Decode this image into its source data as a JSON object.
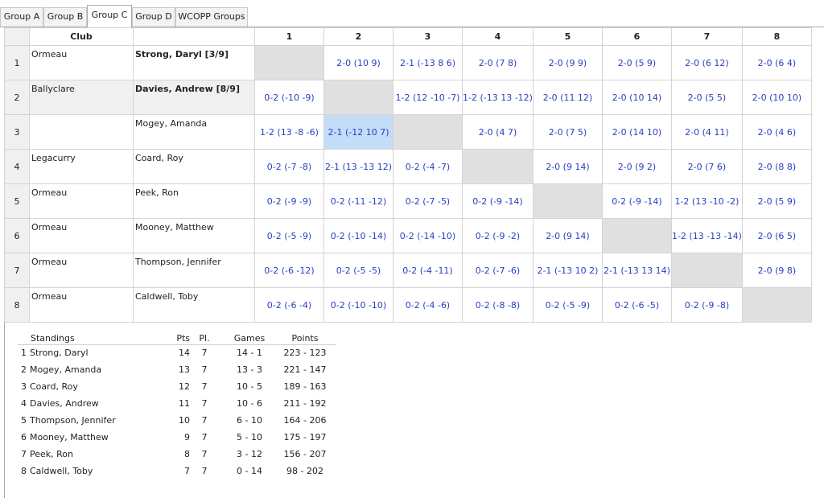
{
  "tabs": [
    {
      "label": "Group A",
      "active": false
    },
    {
      "label": "Group B",
      "active": false
    },
    {
      "label": "Group C",
      "active": true
    },
    {
      "label": "Group D",
      "active": false
    },
    {
      "label": "WCOPP Groups",
      "active": false
    }
  ],
  "grid": {
    "club_header": "Club",
    "columns": [
      "1",
      "2",
      "3",
      "4",
      "5",
      "6",
      "7",
      "8"
    ],
    "rows": [
      {
        "num": "1",
        "club": "Ormeau",
        "player": "Strong, Daryl [3/9]",
        "bold": true,
        "scores": [
          "",
          "2-0 (10 9)",
          "2-1 (-13 8 6)",
          "2-0 (7 8)",
          "2-0 (9 9)",
          "2-0 (5 9)",
          "2-0 (6 12)",
          "2-0 (6 4)"
        ]
      },
      {
        "num": "2",
        "club": "Ballyclare",
        "player": "Davies, Andrew [8/9]",
        "bold": true,
        "scores": [
          "0-2 (-10 -9)",
          "",
          "1-2 (12 -10 -7)",
          "1-2 (-13 13 -12)",
          "2-0 (11 12)",
          "2-0 (10 14)",
          "2-0 (5 5)",
          "2-0 (10 10)"
        ]
      },
      {
        "num": "3",
        "club": "",
        "player": "Mogey, Amanda",
        "bold": false,
        "scores": [
          "1-2 (13 -8 -6)",
          "2-1 (-12 10 7)",
          "",
          "2-0 (4 7)",
          "2-0 (7 5)",
          "2-0 (14 10)",
          "2-0 (4 11)",
          "2-0 (4 6)"
        ]
      },
      {
        "num": "4",
        "club": "Legacurry",
        "player": "Coard, Roy",
        "bold": false,
        "scores": [
          "0-2 (-7 -8)",
          "2-1 (13 -13 12)",
          "0-2 (-4 -7)",
          "",
          "2-0 (9 14)",
          "2-0 (9 2)",
          "2-0 (7 6)",
          "2-0 (8 8)"
        ]
      },
      {
        "num": "5",
        "club": "Ormeau",
        "player": "Peek, Ron",
        "bold": false,
        "scores": [
          "0-2 (-9 -9)",
          "0-2 (-11 -12)",
          "0-2 (-7 -5)",
          "0-2 (-9 -14)",
          "",
          "0-2 (-9 -14)",
          "1-2 (13 -10 -2)",
          "2-0 (5 9)"
        ]
      },
      {
        "num": "6",
        "club": "Ormeau",
        "player": "Mooney, Matthew",
        "bold": false,
        "scores": [
          "0-2 (-5 -9)",
          "0-2 (-10 -14)",
          "0-2 (-14 -10)",
          "0-2 (-9 -2)",
          "2-0 (9 14)",
          "",
          "1-2 (13 -13 -14)",
          "2-0 (6 5)"
        ]
      },
      {
        "num": "7",
        "club": "Ormeau",
        "player": "Thompson, Jennifer",
        "bold": false,
        "scores": [
          "0-2 (-6 -12)",
          "0-2 (-5 -5)",
          "0-2 (-4 -11)",
          "0-2 (-7 -6)",
          "2-1 (-13 10 2)",
          "2-1 (-13 13 14)",
          "",
          "2-0 (9 8)"
        ]
      },
      {
        "num": "8",
        "club": "Ormeau",
        "player": "Caldwell, Toby",
        "bold": false,
        "scores": [
          "0-2 (-6 -4)",
          "0-2 (-10 -10)",
          "0-2 (-4 -6)",
          "0-2 (-8 -8)",
          "0-2 (-5 -9)",
          "0-2 (-6 -5)",
          "0-2 (-9 -8)",
          ""
        ]
      }
    ],
    "selected_cell": {
      "row": 3,
      "col": 2
    },
    "score_color": "#2a3fbf",
    "diagonal_color": "#e0e0e0",
    "selected_color": "#c3dcf7"
  },
  "standings": {
    "headers": {
      "name": "Standings",
      "pts": "Pts",
      "pl": "Pl.",
      "games": "Games",
      "points": "Points"
    },
    "rows": [
      {
        "rank": "1",
        "name": "Strong, Daryl",
        "pts": "14",
        "pl": "7",
        "games": "14 - 1",
        "points": "223 - 123"
      },
      {
        "rank": "2",
        "name": "Mogey, Amanda",
        "pts": "13",
        "pl": "7",
        "games": "13 - 3",
        "points": "221 - 147"
      },
      {
        "rank": "3",
        "name": "Coard, Roy",
        "pts": "12",
        "pl": "7",
        "games": "10 - 5",
        "points": "189 - 163"
      },
      {
        "rank": "4",
        "name": "Davies, Andrew",
        "pts": "11",
        "pl": "7",
        "games": "10 - 6",
        "points": "211 - 192"
      },
      {
        "rank": "5",
        "name": "Thompson, Jennifer",
        "pts": "10",
        "pl": "7",
        "games": "6 - 10",
        "points": "164 - 206"
      },
      {
        "rank": "6",
        "name": "Mooney, Matthew",
        "pts": "9",
        "pl": "7",
        "games": "5 - 10",
        "points": "175 - 197"
      },
      {
        "rank": "7",
        "name": "Peek, Ron",
        "pts": "8",
        "pl": "7",
        "games": "3 - 12",
        "points": "156 - 207"
      },
      {
        "rank": "8",
        "name": "Caldwell, Toby",
        "pts": "7",
        "pl": "7",
        "games": "0 - 14",
        "points": "98 - 202"
      }
    ]
  }
}
